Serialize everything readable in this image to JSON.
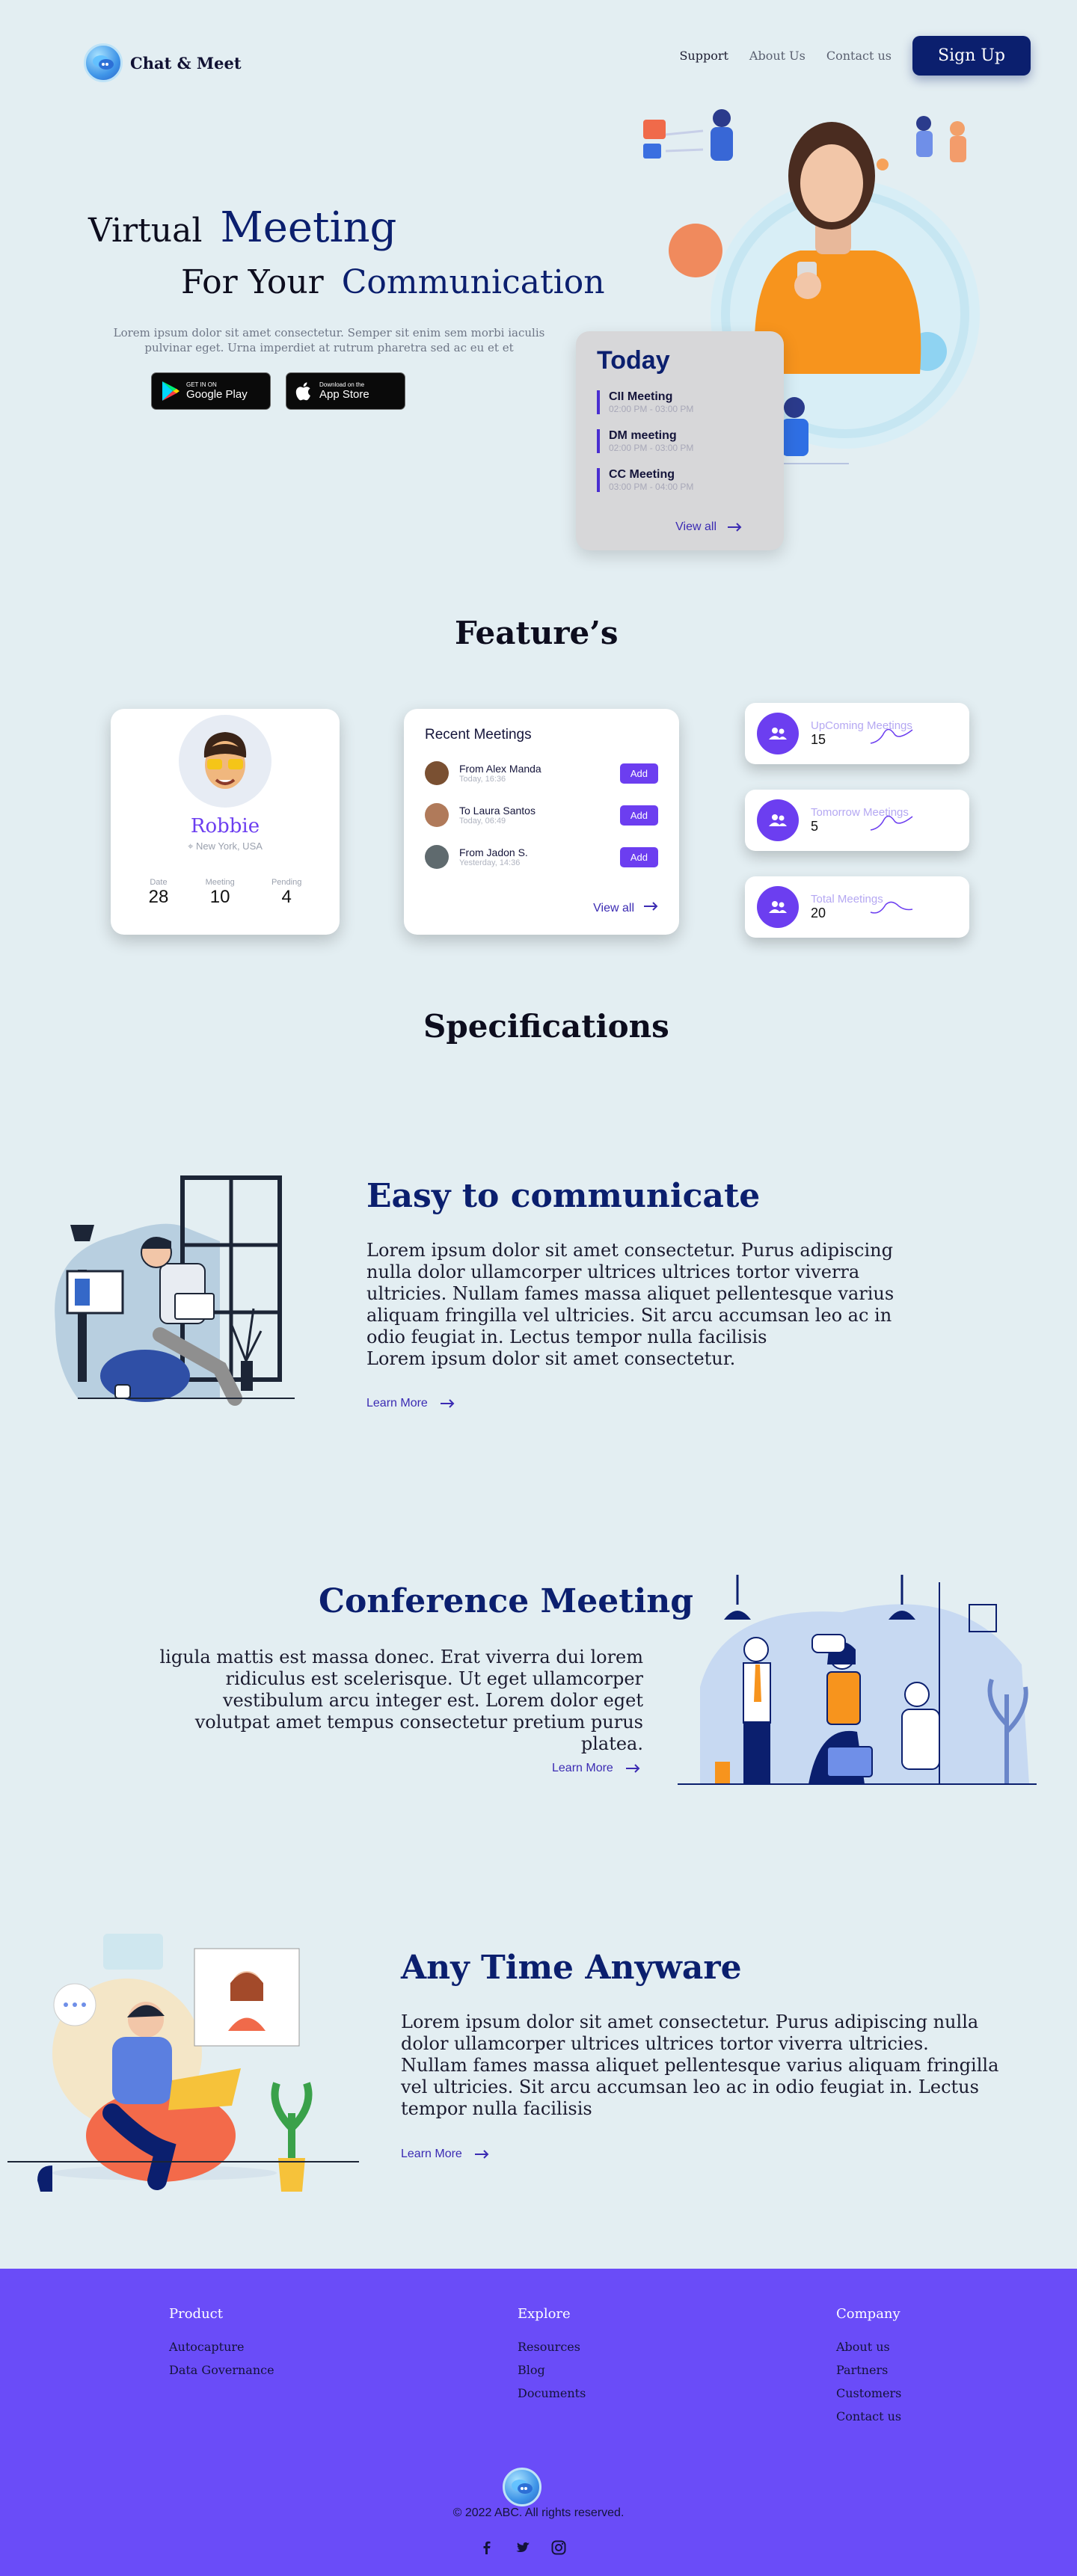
{
  "header": {
    "brand": "Chat & Meet",
    "nav": [
      "Support",
      "About Us",
      "Contact us"
    ],
    "signup": "Sign Up"
  },
  "hero": {
    "line1_dark": "Virtual",
    "line1_blue": "Meeting",
    "line2_dark": "For Your",
    "line2_blue": "Communication",
    "subtitle": "Lorem ipsum dolor sit amet consectetur. Semper sit enim sem morbi iaculis pulvinar eget. Urna imperdiet at rutrum pharetra sed ac eu et et",
    "google_small": "GET IN ON",
    "google_big": "Google Play",
    "apple_small": "Download on the",
    "apple_big": "App Store"
  },
  "today": {
    "title": "Today",
    "items": [
      {
        "title": "CII Meeting",
        "time": "02:00 PM - 03:00 PM"
      },
      {
        "title": "DM meeting",
        "time": "02:00 PM - 03:00 PM"
      },
      {
        "title": "CC Meeting",
        "time": "03:00 PM - 04:00 PM"
      }
    ],
    "view_all": "View all"
  },
  "features": {
    "title": "Feature’s",
    "profile": {
      "name": "Robbie",
      "location": "New York, USA",
      "stats": [
        {
          "label": "Date",
          "value": "28"
        },
        {
          "label": "Meeting",
          "value": "10"
        },
        {
          "label": "Pending",
          "value": "4"
        }
      ]
    },
    "recent": {
      "title": "Recent Meetings",
      "rows": [
        {
          "name": "From Alex Manda",
          "time": "Today, 16:36",
          "action": "Add"
        },
        {
          "name": "To Laura Santos",
          "time": "Today, 06:49",
          "action": "Add"
        },
        {
          "name": "From Jadon S.",
          "time": "Yesterday, 14:36",
          "action": "Add"
        }
      ],
      "view_all": "View all"
    },
    "stats": [
      {
        "label": "UpComing Meetings",
        "value": "15"
      },
      {
        "label": "Tomorrow Meetings",
        "value": "5"
      },
      {
        "label": "Total Meetings",
        "value": "20"
      }
    ]
  },
  "specs": {
    "title": "Specifications",
    "items": [
      {
        "title": "Easy to communicate",
        "body": "Lorem ipsum dolor sit amet consectetur. Purus adipiscing nulla dolor ullamcorper ultrices ultrices tortor viverra ultricies. Nullam fames massa aliquet pellentesque varius aliquam fringilla vel ultricies. Sit arcu accumsan leo ac in odio feugiat in. Lectus tempor nulla facilisis\nLorem ipsum dolor sit amet consectetur.",
        "link": "Learn More"
      },
      {
        "title": "Conference Meeting",
        "body": "ligula mattis est massa donec. Erat viverra dui lorem ridiculus est scelerisque. Ut eget ullamcorper vestibulum arcu integer est. Lorem dolor eget volutpat amet tempus consectetur pretium purus platea.",
        "link": "Learn More"
      },
      {
        "title": "Any Time Anyware",
        "body": "Lorem ipsum dolor sit amet consectetur. Purus adipiscing nulla dolor ullamcorper ultrices ultrices tortor viverra ultricies. Nullam fames massa aliquet pellentesque varius aliquam fringilla vel ultricies. Sit arcu accumsan leo ac in odio feugiat in. Lectus tempor nulla facilisis",
        "link": "Learn More"
      }
    ]
  },
  "footer": {
    "columns": [
      {
        "head": "Product",
        "links": [
          "Autocapture",
          "Data Governance"
        ]
      },
      {
        "head": "Explore",
        "links": [
          "Resources",
          "Blog",
          "Documents"
        ]
      },
      {
        "head": "Company",
        "links": [
          "About us",
          "Partners",
          "Customers",
          "Contact us"
        ]
      }
    ],
    "copyright": "© 2022 ABC. All rights reserved."
  },
  "colors": {
    "background": "#e3eef2",
    "navy": "#0b1f6e",
    "accent": "#6c3ef0",
    "footer": "#6a4cf8"
  }
}
